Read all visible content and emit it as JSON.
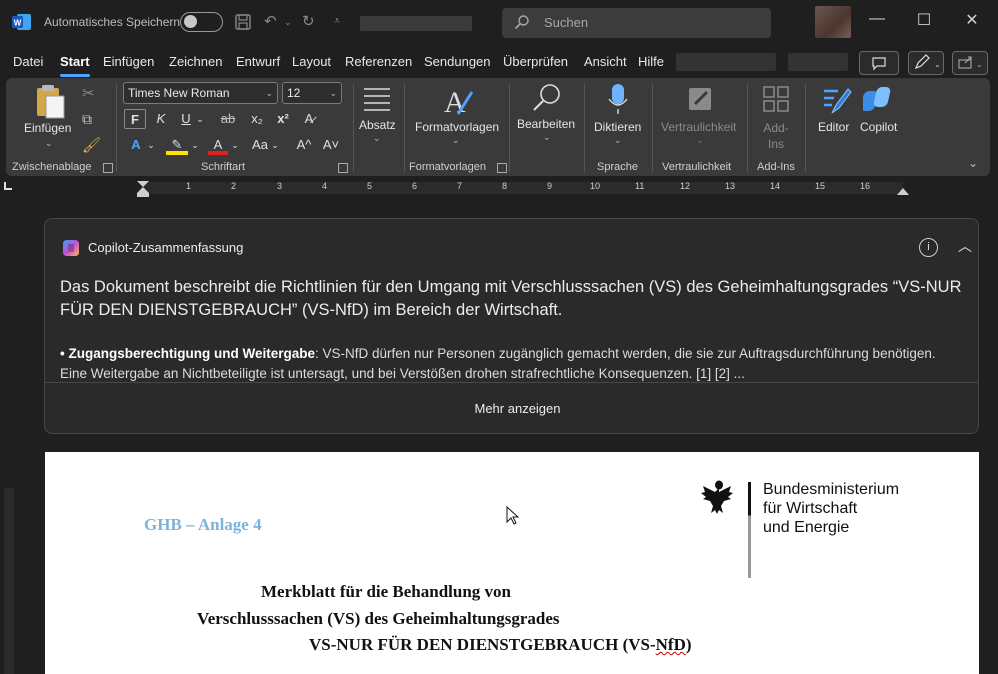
{
  "titlebar": {
    "autosave_label": "Automatisches Speichern",
    "search_placeholder": "Suchen"
  },
  "menu": {
    "tabs": [
      "Datei",
      "Start",
      "Einfügen",
      "Zeichnen",
      "Entwurf",
      "Layout",
      "Referenzen",
      "Sendungen",
      "Überprüfen",
      "Ansicht",
      "Hilfe"
    ],
    "active_tab": "Start"
  },
  "ribbon": {
    "paste_label": "Einfügen",
    "clipboard_group": "Zwischenablage",
    "font_name": "Times New Roman",
    "font_size": "12",
    "bold": "F",
    "italic": "K",
    "underline": "U",
    "strike": "ab",
    "subscript": "x₂",
    "superscript": "x²",
    "font_case": "Aa",
    "grow": "A^",
    "shrink": "A˅",
    "font_group": "Schriftart",
    "paragraph_label": "Absatz",
    "styles_label": "Formatvorlagen",
    "styles_group": "Formatvorlagen",
    "edit_label": "Bearbeiten",
    "dictate_label": "Diktieren",
    "voice_group": "Sprache",
    "sensitivity_label": "Vertraulichkeit",
    "sensitivity_group": "Vertraulichkeit",
    "addins_label": "Add-Ins",
    "addins_group": "Add-Ins",
    "editor_label": "Editor",
    "copilot_label": "Copilot"
  },
  "ruler": {
    "numbers": [
      "1",
      "2",
      "3",
      "4",
      "5",
      "6",
      "7",
      "8",
      "9",
      "10",
      "11",
      "12",
      "13",
      "14",
      "15",
      "16"
    ]
  },
  "copilot_summary": {
    "title": "Copilot-Zusammenfassung",
    "summary": "Das Dokument beschreibt die Richtlinien für den Umgang mit Verschlusssachen (VS) des Geheimhaltungsgrades “VS-NUR FÜR DEN DIENSTGEBRAUCH” (VS-NfD) im Bereich der Wirtschaft.",
    "bullet_heading": "• Zugangsberechtigung und Weitergabe",
    "bullet_text": ": VS-NfD dürfen nur Personen zugänglich gemacht werden, die sie zur Auftragsdurchführung benötigen. Eine Weitergabe an Nichtbeteiligte ist untersagt, und bei Verstößen drohen strafrechtliche Konsequenzen. [1] [2] ...",
    "more_button": "Mehr anzeigen"
  },
  "document": {
    "annex": "GHB – Anlage 4",
    "ministry_line1": "Bundesministerium",
    "ministry_line2": "für Wirtschaft",
    "ministry_line3": "und Energie",
    "title_line1": "Merkblatt für die Behandlung von",
    "title_line2": "Verschlusssachen (VS) des Geheimhaltungsgrades",
    "title_line3_a": "VS-NUR FÜR DEN DIENSTGEBRAUCH (VS-",
    "title_line3_b": "NfD",
    "title_line3_c": ")"
  }
}
